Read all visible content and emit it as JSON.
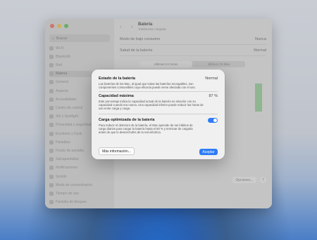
{
  "sidebar": {
    "search_placeholder": "Buscar",
    "items": [
      {
        "label": "Wi-Fi"
      },
      {
        "label": "Bluetooth"
      },
      {
        "label": "Red"
      },
      {
        "label": "Batería"
      },
      {
        "label": "General"
      },
      {
        "label": "Aspecto"
      },
      {
        "label": "Accesibilidad"
      },
      {
        "label": "Centro de control"
      },
      {
        "label": "Siri y Spotlight"
      },
      {
        "label": "Privacidad y seguridad"
      },
      {
        "label": "Escritorio y Dock"
      },
      {
        "label": "Pantallas"
      },
      {
        "label": "Fondo de pantalla"
      },
      {
        "label": "Salvapantallas"
      },
      {
        "label": "Notificaciones"
      },
      {
        "label": "Sonido"
      },
      {
        "label": "Modo de concentración"
      },
      {
        "label": "Tiempo de uso"
      },
      {
        "label": "Pantalla de bloqueo"
      }
    ]
  },
  "main": {
    "title": "Batería",
    "subtitle": "Totalmente cargada",
    "low_power_label": "Modo de bajo consumo",
    "low_power_value": "Nunca",
    "health_label": "Salud de la batería",
    "health_value": "Normal",
    "tabs": [
      {
        "label": "Últimas 24 horas"
      },
      {
        "label": "Últimos 10 días"
      }
    ],
    "options_label": "Opciones...",
    "help_label": "?"
  },
  "dialog": {
    "state_title": "Estado de la batería",
    "state_value": "Normal",
    "state_desc": "Las baterías de los Mac, al igual que todas las baterías recargables, son componentes consumibles cuya eficacia puede verse afectada con el uso.",
    "capacity_title": "Capacidad máxima",
    "capacity_value": "87 %",
    "capacity_desc": "Este porcentaje indica la capacidad actual de la batería en relación con su capacidad cuando era nueva. Una capacidad inferior puede reducir las horas de uso entre carga y carga.",
    "optimized_title": "Carga optimizada de la batería",
    "optimized_on": true,
    "optimized_desc": "Para reducir el deterioro de la batería, el Mac aprende de tus hábitos de carga diarios para cargar la batería hasta el 80 % y terminar de cargarla antes de que lo desenchufes de la red eléctrica.",
    "more_info_label": "Más información...",
    "accept_label": "Aceptar"
  },
  "colors": {
    "accent": "#2e7cf6",
    "close": "#ff5f57",
    "minimize": "#febc2e",
    "zoom": "#28c840"
  }
}
